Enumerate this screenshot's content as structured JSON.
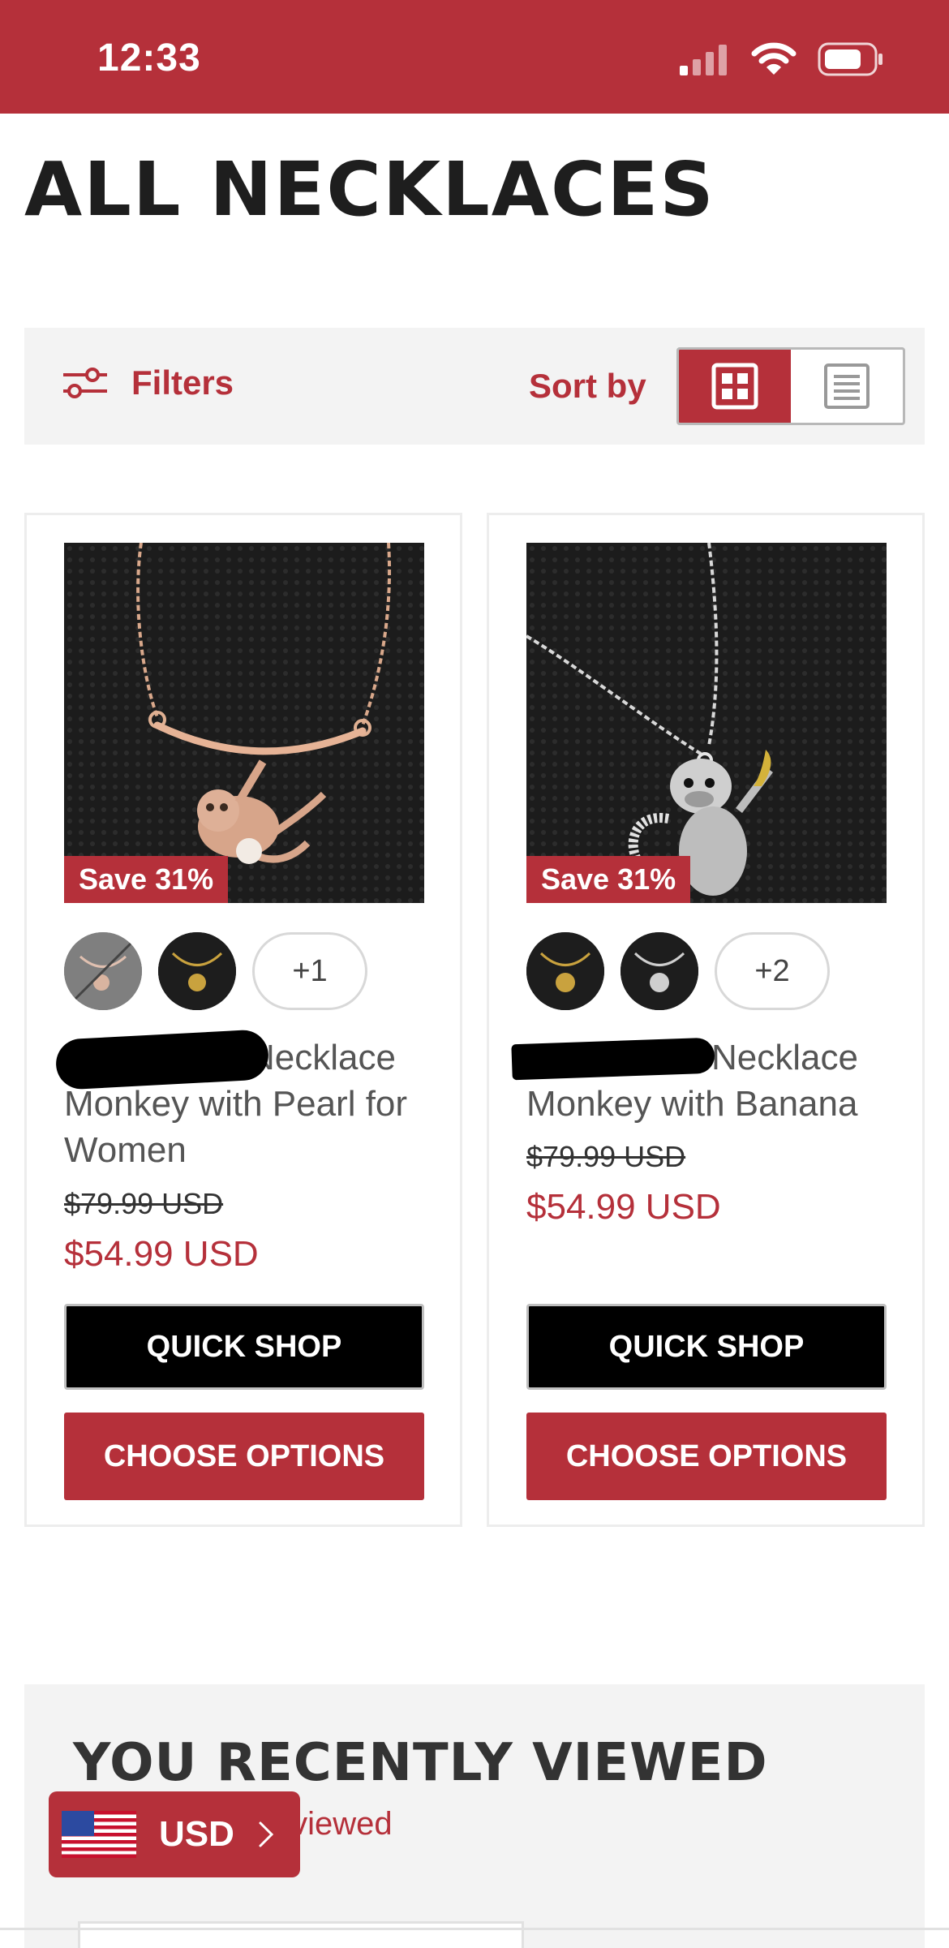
{
  "status_bar": {
    "time": "12:33"
  },
  "page": {
    "title": "ALL NECKLACES"
  },
  "toolbar": {
    "filters_label": "Filters",
    "sort_label": "Sort by",
    "view_modes": [
      "grid",
      "list"
    ],
    "active_view": "grid"
  },
  "products": [
    {
      "badge": "Save 31%",
      "swatch_more": "+1",
      "name_visible_start": "Necklace",
      "name_rest": "Monkey with Pearl for Women",
      "price_old": "$79.99 USD",
      "price_new": "$54.99 USD",
      "quick_shop": "QUICK SHOP",
      "choose_options": "CHOOSE OPTIONS"
    },
    {
      "badge": "Save 31%",
      "swatch_more": "+2",
      "name_visible_start": "Necklace",
      "name_rest": "Monkey with Banana",
      "price_old": "$79.99 USD",
      "price_new": "$54.99 USD",
      "quick_shop": "QUICK SHOP",
      "choose_options": "CHOOSE OPTIONS"
    }
  ],
  "recently_viewed": {
    "title": "YOU RECENTLY VIEWED",
    "subtitle_fragment": "y viewed"
  },
  "currency": {
    "label": "USD",
    "icon": "us-flag-icon"
  },
  "colors": {
    "brand_red": "#b5303a",
    "black": "#000000",
    "toolbar_bg": "#f3f3f3"
  }
}
